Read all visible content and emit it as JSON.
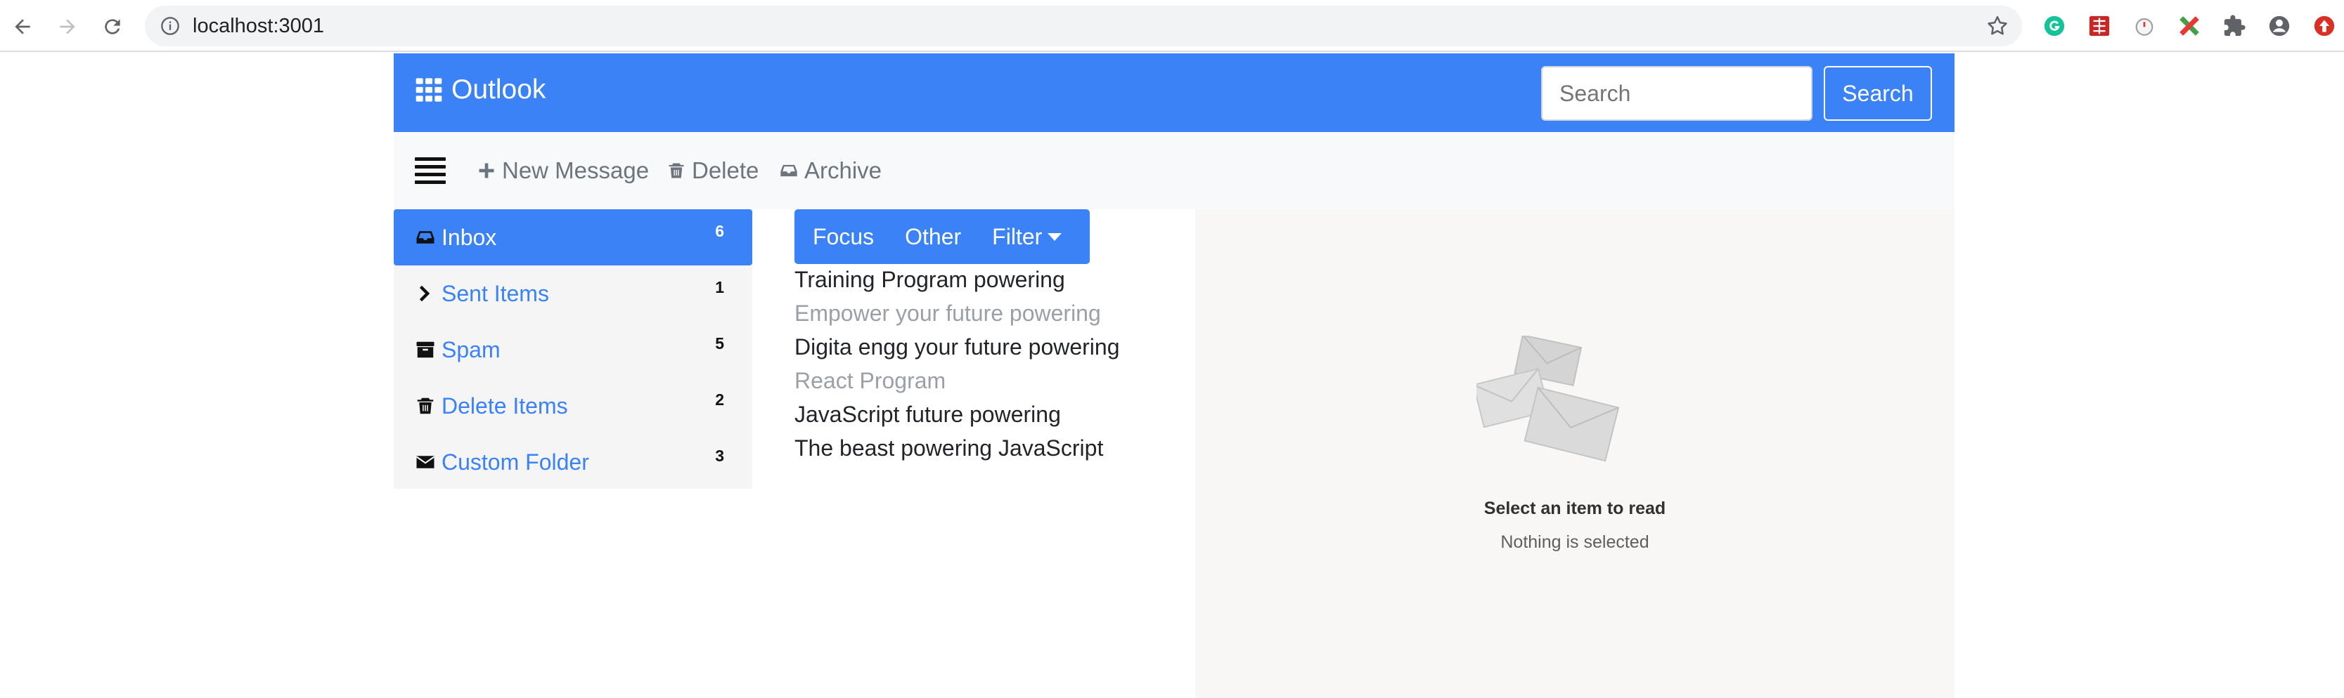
{
  "browser": {
    "url": "localhost:3001"
  },
  "app": {
    "title": "Outlook",
    "search": {
      "placeholder": "Search",
      "button_label": "Search"
    }
  },
  "toolbar": {
    "new_message": "New Message",
    "delete": "Delete",
    "archive": "Archive"
  },
  "sidebar": {
    "items": [
      {
        "label": "Inbox",
        "count": "6",
        "icon": "inbox-icon",
        "active": true
      },
      {
        "label": "Sent Items",
        "count": "1",
        "icon": "chevron-right-icon"
      },
      {
        "label": "Spam",
        "count": "5",
        "icon": "archive-box-icon"
      },
      {
        "label": "Delete Items",
        "count": "2",
        "icon": "trash-icon"
      },
      {
        "label": "Custom Folder",
        "count": "3",
        "icon": "envelope-icon"
      }
    ]
  },
  "tabs": {
    "focus": "Focus",
    "other": "Other",
    "filter": "Filter"
  },
  "messages": [
    {
      "subject": "Training Program powering",
      "read": false
    },
    {
      "subject": "Empower your future powering",
      "read": true
    },
    {
      "subject": "Digita engg your future powering",
      "read": false
    },
    {
      "subject": "React Program",
      "read": true
    },
    {
      "subject": "JavaScript future powering",
      "read": false
    },
    {
      "subject": "The beast powering JavaScript",
      "read": false
    }
  ],
  "reading_pane": {
    "title": "Select an item to read",
    "subtitle": "Nothing is selected"
  },
  "colors": {
    "accent": "#3b82f6",
    "read_text": "#9aa0a6",
    "unread_text": "#212529"
  }
}
